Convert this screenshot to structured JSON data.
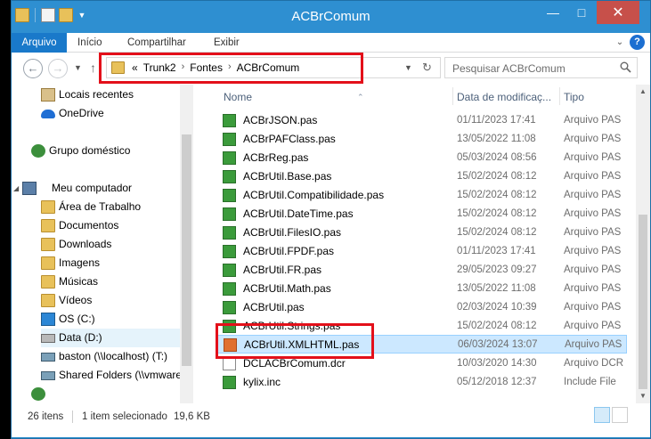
{
  "window": {
    "title": "ACBrComum",
    "minimize": "—",
    "maximize": "□",
    "close": "✕"
  },
  "ribbon": {
    "file": "Arquivo",
    "tabs": [
      "Início",
      "Compartilhar",
      "Exibir"
    ]
  },
  "address": {
    "prefix": "«",
    "crumbs": [
      "Trunk2",
      "Fontes",
      "ACBrComum"
    ],
    "search_placeholder": "Pesquisar ACBrComum"
  },
  "nav": [
    {
      "label": "Locais recentes",
      "icon": "recent-places-icon"
    },
    {
      "label": "OneDrive",
      "icon": "onedrive-icon"
    },
    {
      "label": "Grupo doméstico",
      "icon": "homegroup-icon"
    },
    {
      "label": "Meu computador",
      "icon": "computer-icon"
    },
    {
      "label": "Área de Trabalho",
      "icon": "folder-icon"
    },
    {
      "label": "Documentos",
      "icon": "folder-icon"
    },
    {
      "label": "Downloads",
      "icon": "folder-icon"
    },
    {
      "label": "Imagens",
      "icon": "folder-icon"
    },
    {
      "label": "Músicas",
      "icon": "folder-icon"
    },
    {
      "label": "Vídeos",
      "icon": "folder-icon"
    },
    {
      "label": "OS (C:)",
      "icon": "windows-drive-icon"
    },
    {
      "label": "Data (D:)",
      "icon": "drive-icon"
    },
    {
      "label": "baston (\\\\localhost) (T:)",
      "icon": "network-drive-icon"
    },
    {
      "label": "Shared Folders (\\\\vmware",
      "icon": "network-drive-icon"
    }
  ],
  "columns": {
    "name": "Nome",
    "date": "Data de modificaç...",
    "type": "Tipo"
  },
  "files": [
    {
      "name": "ACBrJSON.pas",
      "date": "01/11/2023 17:41",
      "type": "Arquivo PAS"
    },
    {
      "name": "ACBrPAFClass.pas",
      "date": "13/05/2022 11:08",
      "type": "Arquivo PAS"
    },
    {
      "name": "ACBrReg.pas",
      "date": "05/03/2024 08:56",
      "type": "Arquivo PAS"
    },
    {
      "name": "ACBrUtil.Base.pas",
      "date": "15/02/2024 08:12",
      "type": "Arquivo PAS"
    },
    {
      "name": "ACBrUtil.Compatibilidade.pas",
      "date": "15/02/2024 08:12",
      "type": "Arquivo PAS"
    },
    {
      "name": "ACBrUtil.DateTime.pas",
      "date": "15/02/2024 08:12",
      "type": "Arquivo PAS"
    },
    {
      "name": "ACBrUtil.FilesIO.pas",
      "date": "15/02/2024 08:12",
      "type": "Arquivo PAS"
    },
    {
      "name": "ACBrUtil.FPDF.pas",
      "date": "01/11/2023 17:41",
      "type": "Arquivo PAS"
    },
    {
      "name": "ACBrUtil.FR.pas",
      "date": "29/05/2023 09:27",
      "type": "Arquivo PAS"
    },
    {
      "name": "ACBrUtil.Math.pas",
      "date": "13/05/2022 11:08",
      "type": "Arquivo PAS"
    },
    {
      "name": "ACBrUtil.pas",
      "date": "02/03/2024 10:39",
      "type": "Arquivo PAS"
    },
    {
      "name": "ACBrUtil.Strings.pas",
      "date": "15/02/2024 08:12",
      "type": "Arquivo PAS"
    },
    {
      "name": "ACBrUtil.XMLHTML.pas",
      "date": "06/03/2024 13:07",
      "type": "Arquivo PAS"
    },
    {
      "name": "DCLACBrComum.dcr",
      "date": "10/03/2020 14:30",
      "type": "Arquivo DCR"
    },
    {
      "name": "kylix.inc",
      "date": "05/12/2018 12:37",
      "type": "Include File"
    }
  ],
  "status": {
    "count": "26 itens",
    "selected": "1 item selecionado",
    "size": "19,6 KB"
  },
  "colors": {
    "titlebar": "#2e8fd1",
    "file_tab": "#1979ca",
    "close": "#c7504a",
    "highlight": "#e3101a",
    "selection": "#cce8ff"
  }
}
